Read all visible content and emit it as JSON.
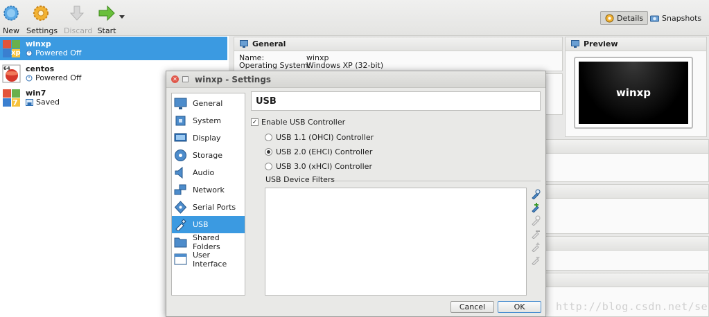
{
  "toolbar": {
    "new_label": "New",
    "settings_label": "Settings",
    "discard_label": "Discard",
    "start_label": "Start",
    "details_label": "Details",
    "snapshots_label": "Snapshots"
  },
  "vms": [
    {
      "name": "winxp",
      "state": "Powered Off",
      "os_badge": "xp"
    },
    {
      "name": "centos",
      "state": "Powered Off",
      "os_badge": "64"
    },
    {
      "name": "win7",
      "state": "Saved",
      "os_badge": "7"
    }
  ],
  "details": {
    "general_title": "General",
    "name_key": "Name:",
    "name_value": "winxp",
    "os_key": "Operating System:",
    "os_value": "Windows XP (32-bit)",
    "preview_title": "Preview",
    "preview_text": "winxp"
  },
  "dialog": {
    "title": "winxp - Settings",
    "categories": [
      "General",
      "System",
      "Display",
      "Storage",
      "Audio",
      "Network",
      "Serial Ports",
      "USB",
      "Shared Folders",
      "User Interface"
    ],
    "selected_category": "USB",
    "page_title": "USB",
    "enable_usb_label": "Enable USB Controller",
    "enable_usb_checked": true,
    "usb_options": [
      "USB 1.1 (OHCI) Controller",
      "USB 2.0 (EHCI) Controller",
      "USB 3.0 (xHCI) Controller"
    ],
    "usb_selected": "USB 2.0 (EHCI) Controller",
    "filters_label": "USB Device Filters",
    "cancel_label": "Cancel",
    "ok_label": "OK"
  },
  "watermark": "http://blog.csdn.net/selous",
  "colors": {
    "selection": "#3b9ae1",
    "close": "#e0574a"
  }
}
